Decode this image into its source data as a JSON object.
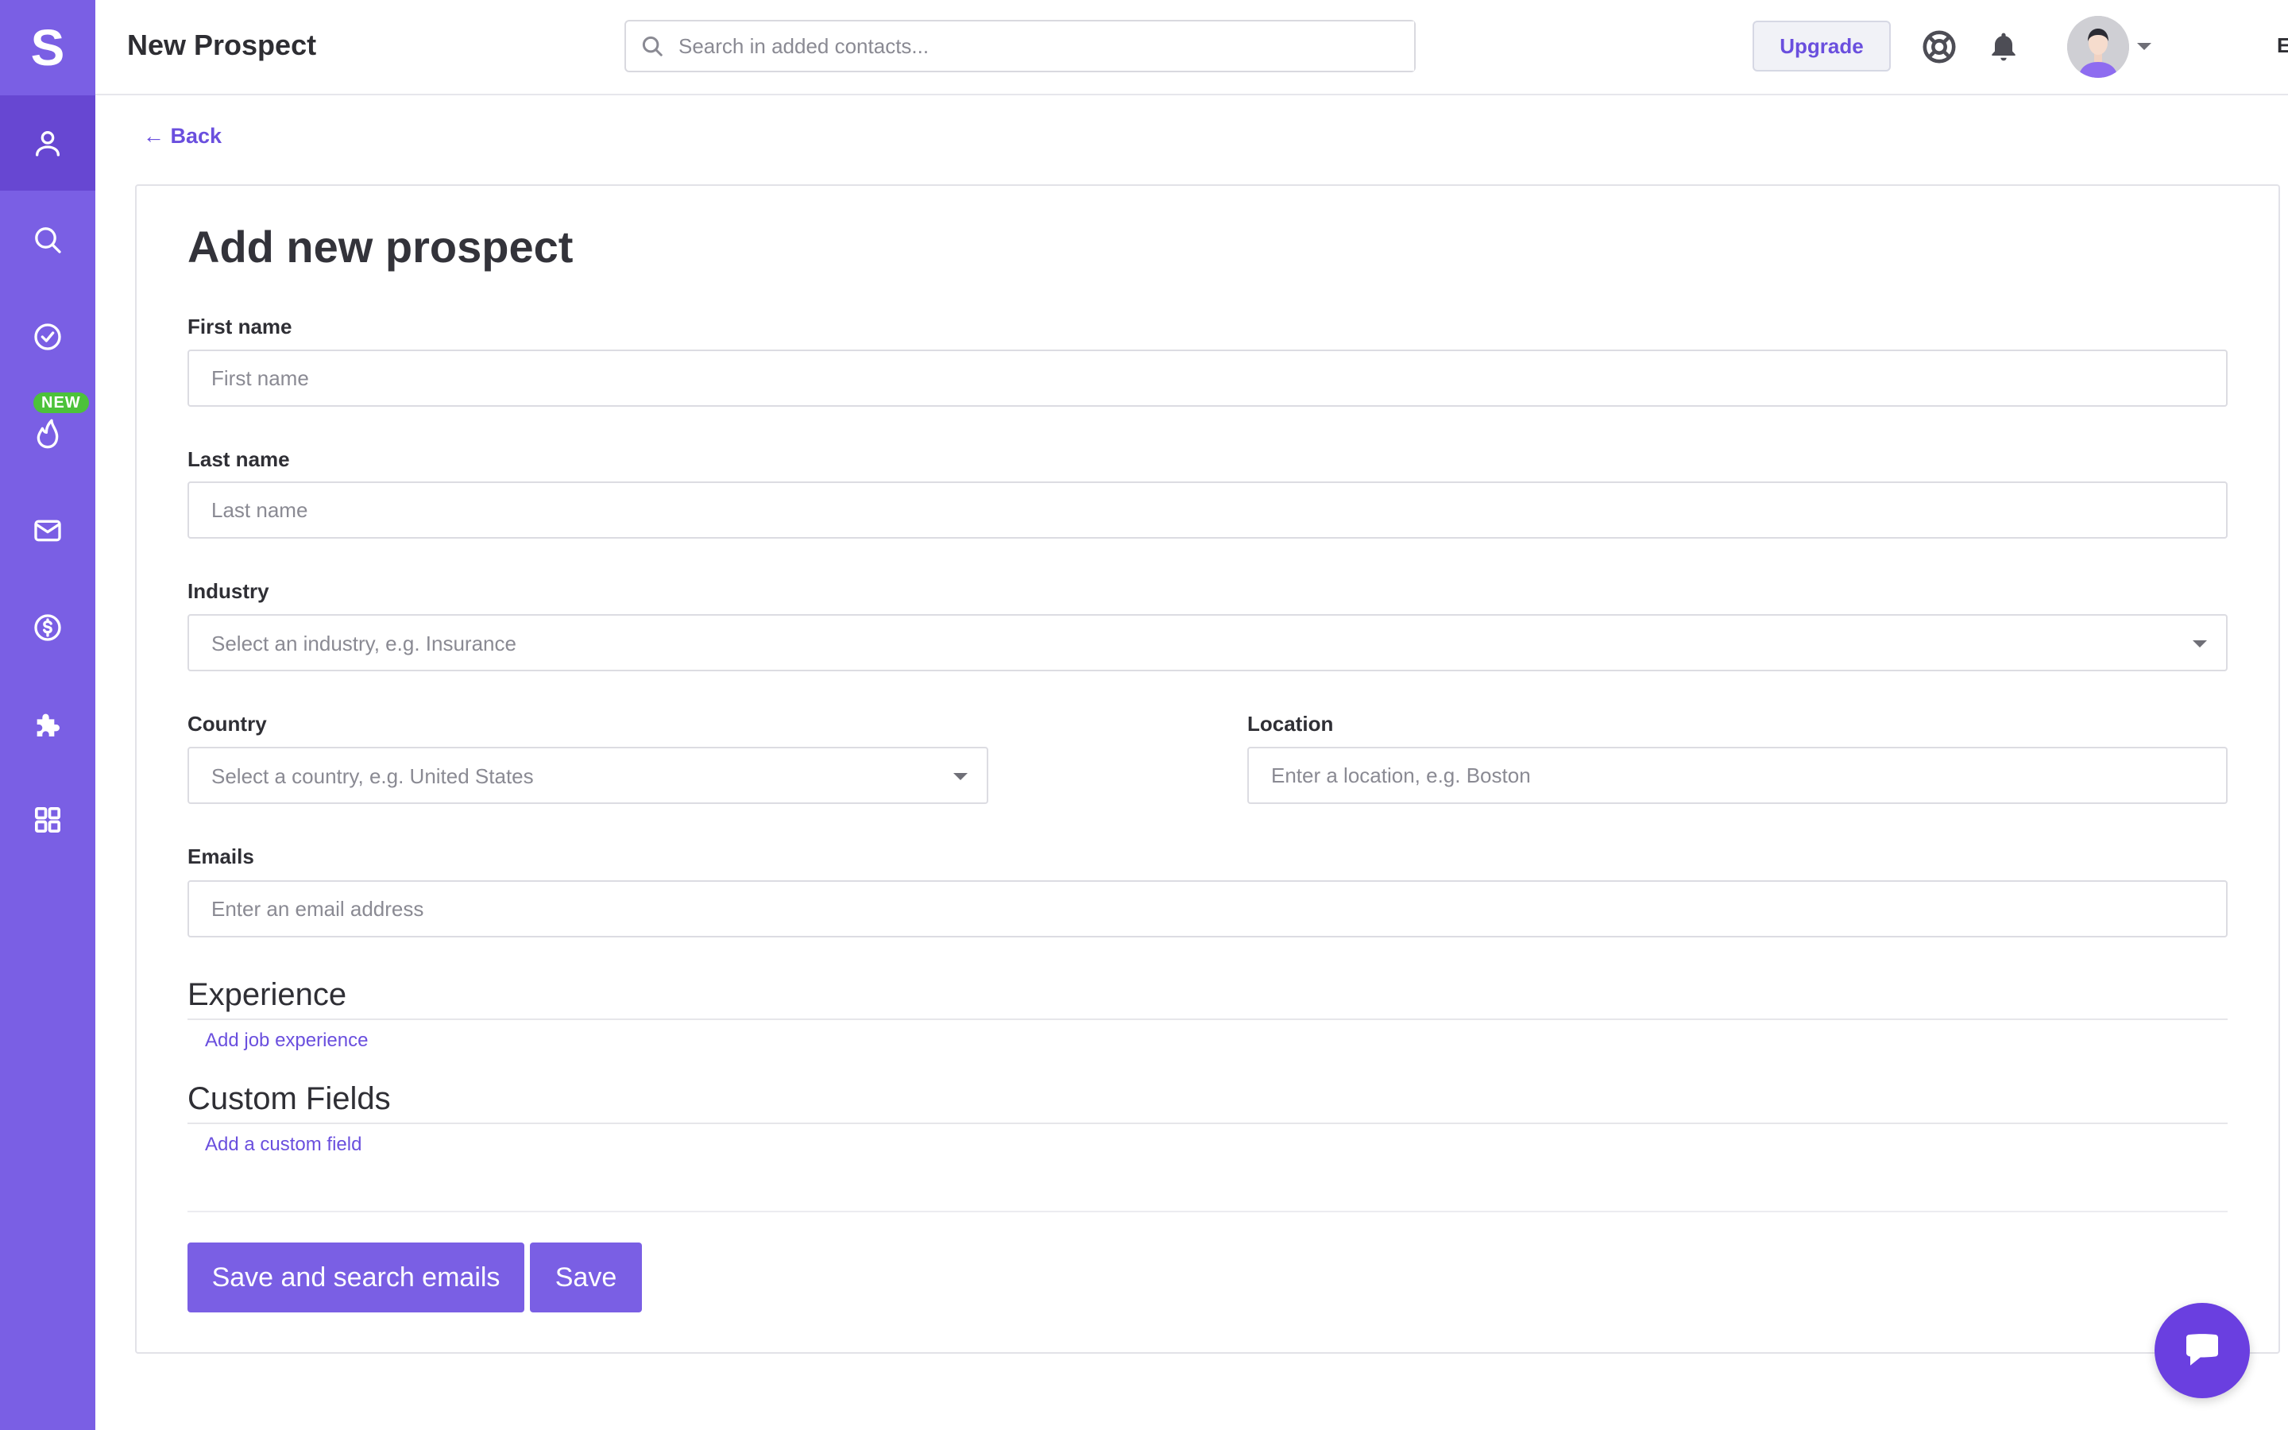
{
  "app": {
    "logo_letter": "S",
    "new_badge": "NEW",
    "accent_color": "#7a5fe4"
  },
  "sidebar": {
    "items": [
      {
        "icon": "user-icon",
        "active": true
      },
      {
        "icon": "search-icon",
        "active": false
      },
      {
        "icon": "check-circle-icon",
        "active": false
      },
      {
        "icon": "flame-icon",
        "active": false,
        "badge": "NEW"
      },
      {
        "icon": "mail-icon",
        "active": false
      },
      {
        "icon": "dollar-circle-icon",
        "active": false
      },
      {
        "icon": "puzzle-icon",
        "active": false
      },
      {
        "icon": "grid-icon",
        "active": false
      }
    ]
  },
  "header": {
    "title": "New Prospect",
    "search_placeholder": "Search in added contacts...",
    "upgrade_label": "Upgrade",
    "language": "EN"
  },
  "main": {
    "back_label": "← Back",
    "heading": "Add new prospect",
    "fields": {
      "first_name": {
        "label": "First name",
        "placeholder": "First name"
      },
      "last_name": {
        "label": "Last name",
        "placeholder": "Last name"
      },
      "industry": {
        "label": "Industry",
        "placeholder": "Select an industry, e.g. Insurance"
      },
      "country": {
        "label": "Country",
        "placeholder": "Select a country, e.g. United States"
      },
      "location": {
        "label": "Location",
        "placeholder": "Enter a location, e.g. Boston"
      },
      "emails": {
        "label": "Emails",
        "placeholder": "Enter an email address"
      }
    },
    "experience": {
      "title": "Experience",
      "add_label": "Add job experience"
    },
    "custom_fields": {
      "title": "Custom Fields",
      "add_label": "Add a custom field"
    },
    "buttons": {
      "save_and_search": "Save and search emails",
      "save": "Save"
    }
  }
}
